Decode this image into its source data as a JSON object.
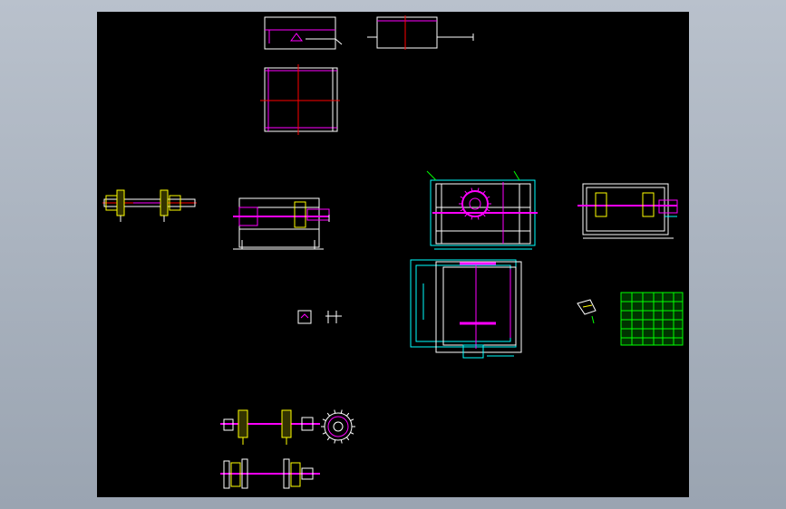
{
  "viewer": {
    "background": "#a9b2be",
    "sheet_color": "#000000"
  },
  "palette": {
    "white": "#ffffff",
    "magenta": "#ff00ff",
    "red": "#ff0000",
    "cyan": "#00ffff",
    "yellow": "#ffff00",
    "green": "#00ff00"
  },
  "views": [
    "top-panel-elevation",
    "top-panel-side",
    "frame-plan",
    "left-shaft-assembly",
    "front-elevation",
    "small-section-details",
    "main-front-view",
    "side-view",
    "plan-view",
    "gear-detail",
    "parts-list-table",
    "shaft-with-sprockets",
    "sprocket-wheel",
    "shaft-with-discs"
  ]
}
